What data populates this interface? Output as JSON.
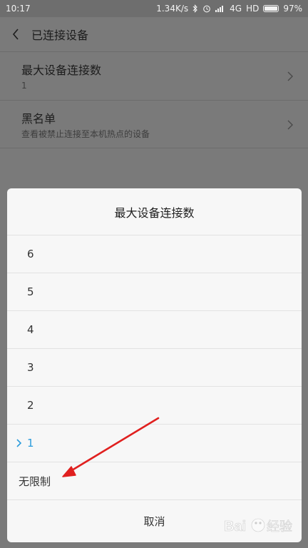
{
  "status_bar": {
    "time": "10:17",
    "speed": "1.34K/s",
    "icons": [
      "bluetooth-icon",
      "alarm-icon",
      "signal-icon"
    ],
    "network": "4G",
    "hd": "HD",
    "battery": "97%",
    "battery_level": 0.97
  },
  "header": {
    "title": "已连接设备",
    "back_icon": "chevron-left-icon"
  },
  "settings": {
    "items": [
      {
        "title": "最大设备连接数",
        "subtitle": "1"
      },
      {
        "title": "黑名单",
        "subtitle": "查看被禁止连接至本机热点的设备"
      }
    ]
  },
  "dialog": {
    "title": "最大设备连接数",
    "options": [
      {
        "label": "6",
        "selected": false
      },
      {
        "label": "5",
        "selected": false
      },
      {
        "label": "4",
        "selected": false
      },
      {
        "label": "3",
        "selected": false
      },
      {
        "label": "2",
        "selected": false
      },
      {
        "label": "1",
        "selected": true
      },
      {
        "label": "无限制",
        "selected": false
      }
    ],
    "cancel": "取消"
  },
  "colors": {
    "accent": "#2b9cdc",
    "annotation_arrow": "#e0201f",
    "dim_background": "#7a7a7a",
    "dialog_bg": "#f7f7f7"
  },
  "watermark": {
    "brand": "Baidu",
    "text": "经验"
  }
}
